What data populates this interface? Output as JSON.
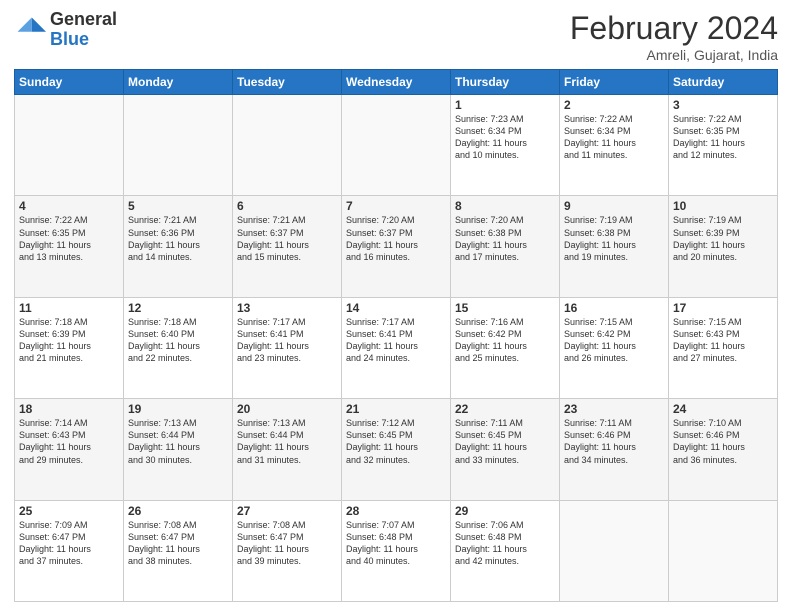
{
  "header": {
    "logo_general": "General",
    "logo_blue": "Blue",
    "title": "February 2024",
    "location": "Amreli, Gujarat, India"
  },
  "days_of_week": [
    "Sunday",
    "Monday",
    "Tuesday",
    "Wednesday",
    "Thursday",
    "Friday",
    "Saturday"
  ],
  "weeks": [
    [
      {
        "day": "",
        "info": ""
      },
      {
        "day": "",
        "info": ""
      },
      {
        "day": "",
        "info": ""
      },
      {
        "day": "",
        "info": ""
      },
      {
        "day": "1",
        "info": "Sunrise: 7:23 AM\nSunset: 6:34 PM\nDaylight: 11 hours\nand 10 minutes."
      },
      {
        "day": "2",
        "info": "Sunrise: 7:22 AM\nSunset: 6:34 PM\nDaylight: 11 hours\nand 11 minutes."
      },
      {
        "day": "3",
        "info": "Sunrise: 7:22 AM\nSunset: 6:35 PM\nDaylight: 11 hours\nand 12 minutes."
      }
    ],
    [
      {
        "day": "4",
        "info": "Sunrise: 7:22 AM\nSunset: 6:35 PM\nDaylight: 11 hours\nand 13 minutes."
      },
      {
        "day": "5",
        "info": "Sunrise: 7:21 AM\nSunset: 6:36 PM\nDaylight: 11 hours\nand 14 minutes."
      },
      {
        "day": "6",
        "info": "Sunrise: 7:21 AM\nSunset: 6:37 PM\nDaylight: 11 hours\nand 15 minutes."
      },
      {
        "day": "7",
        "info": "Sunrise: 7:20 AM\nSunset: 6:37 PM\nDaylight: 11 hours\nand 16 minutes."
      },
      {
        "day": "8",
        "info": "Sunrise: 7:20 AM\nSunset: 6:38 PM\nDaylight: 11 hours\nand 17 minutes."
      },
      {
        "day": "9",
        "info": "Sunrise: 7:19 AM\nSunset: 6:38 PM\nDaylight: 11 hours\nand 19 minutes."
      },
      {
        "day": "10",
        "info": "Sunrise: 7:19 AM\nSunset: 6:39 PM\nDaylight: 11 hours\nand 20 minutes."
      }
    ],
    [
      {
        "day": "11",
        "info": "Sunrise: 7:18 AM\nSunset: 6:39 PM\nDaylight: 11 hours\nand 21 minutes."
      },
      {
        "day": "12",
        "info": "Sunrise: 7:18 AM\nSunset: 6:40 PM\nDaylight: 11 hours\nand 22 minutes."
      },
      {
        "day": "13",
        "info": "Sunrise: 7:17 AM\nSunset: 6:41 PM\nDaylight: 11 hours\nand 23 minutes."
      },
      {
        "day": "14",
        "info": "Sunrise: 7:17 AM\nSunset: 6:41 PM\nDaylight: 11 hours\nand 24 minutes."
      },
      {
        "day": "15",
        "info": "Sunrise: 7:16 AM\nSunset: 6:42 PM\nDaylight: 11 hours\nand 25 minutes."
      },
      {
        "day": "16",
        "info": "Sunrise: 7:15 AM\nSunset: 6:42 PM\nDaylight: 11 hours\nand 26 minutes."
      },
      {
        "day": "17",
        "info": "Sunrise: 7:15 AM\nSunset: 6:43 PM\nDaylight: 11 hours\nand 27 minutes."
      }
    ],
    [
      {
        "day": "18",
        "info": "Sunrise: 7:14 AM\nSunset: 6:43 PM\nDaylight: 11 hours\nand 29 minutes."
      },
      {
        "day": "19",
        "info": "Sunrise: 7:13 AM\nSunset: 6:44 PM\nDaylight: 11 hours\nand 30 minutes."
      },
      {
        "day": "20",
        "info": "Sunrise: 7:13 AM\nSunset: 6:44 PM\nDaylight: 11 hours\nand 31 minutes."
      },
      {
        "day": "21",
        "info": "Sunrise: 7:12 AM\nSunset: 6:45 PM\nDaylight: 11 hours\nand 32 minutes."
      },
      {
        "day": "22",
        "info": "Sunrise: 7:11 AM\nSunset: 6:45 PM\nDaylight: 11 hours\nand 33 minutes."
      },
      {
        "day": "23",
        "info": "Sunrise: 7:11 AM\nSunset: 6:46 PM\nDaylight: 11 hours\nand 34 minutes."
      },
      {
        "day": "24",
        "info": "Sunrise: 7:10 AM\nSunset: 6:46 PM\nDaylight: 11 hours\nand 36 minutes."
      }
    ],
    [
      {
        "day": "25",
        "info": "Sunrise: 7:09 AM\nSunset: 6:47 PM\nDaylight: 11 hours\nand 37 minutes."
      },
      {
        "day": "26",
        "info": "Sunrise: 7:08 AM\nSunset: 6:47 PM\nDaylight: 11 hours\nand 38 minutes."
      },
      {
        "day": "27",
        "info": "Sunrise: 7:08 AM\nSunset: 6:47 PM\nDaylight: 11 hours\nand 39 minutes."
      },
      {
        "day": "28",
        "info": "Sunrise: 7:07 AM\nSunset: 6:48 PM\nDaylight: 11 hours\nand 40 minutes."
      },
      {
        "day": "29",
        "info": "Sunrise: 7:06 AM\nSunset: 6:48 PM\nDaylight: 11 hours\nand 42 minutes."
      },
      {
        "day": "",
        "info": ""
      },
      {
        "day": "",
        "info": ""
      }
    ]
  ]
}
